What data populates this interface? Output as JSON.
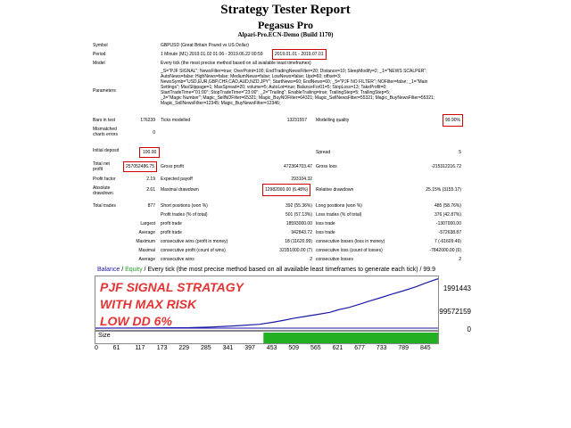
{
  "header": {
    "title": "Strategy Tester Report",
    "ea_name": "Pegasus Pro",
    "account": "Alpari-Pro.ECN-Demo (Build 1170)"
  },
  "report": {
    "symbol_label": "Symbol",
    "symbol_value": "GBPUSD (Great Britain Pound vs US Dollar)",
    "period_label": "Period",
    "period_value": "1 Minute (M1) 2019.01.02 01:06 - 2019.06.22 00:59",
    "period_highlight": "2019.01.01 - 2019.07.01",
    "model_label": "Model",
    "model_value": "Every tick (the most precise method based on all available least timeframes)",
    "params_label": "Parameters",
    "params_lines": [
      "_S=\"PJF SIGNAL\"; NewsFilter=true; OverPoint=100; EndTradingNewsFilter=20; Distance=10; SleepModify=2; _1=\"NEWS SCALPER\";",
      "AutoNews=false; HighNews=false; MediumNews=false; LowNews=false; Upd=60; offset=3;",
      "NewsSymb=\"USD,EUR,GBP,CHF,CAD,AUD,NZD,JPY\"; StartNews=60; EndNews=60; _5=\"PJF NO FILTER\"; NOFilter=false; _1=\"Main",
      "Settings\"; MaxSlippage=1; MaxSpread=20; volume=5; AutoLot=true; BalanceFor01=5; StopLoss=13; TakeProfit=0;",
      "StartTradeTime=\"01:00\"; StopTradeTime=\"23:00\"; _2=\"Trailing\"; EnableTrailing=true; TrailingStep=5; TrailingStep=5;",
      "_3=\"Magic Number\"; Magic_SellNOFilter=65321; Magic_BuyNOFilter=64321; Magic_SellNewsFilter=55321; Magic_BuyNewsFilter=55321;",
      "Magic_SellNewsFilter=12345; Magic_BuyNewsFilter=12346;"
    ],
    "bars_label": "Bars in test",
    "bars_value": "176239",
    "ticks_label": "Ticks modelled",
    "ticks_value": "13231557",
    "quality_label": "Modelling quality",
    "quality_value": "99.90%",
    "mismatch_label": "Mismatched charts errors",
    "mismatch_value": "0",
    "deposit_label": "Initial deposit",
    "deposit_value": "100.00",
    "spread_label": "Spread",
    "spread_value": "5",
    "netprofit_label": "Total net profit",
    "netprofit_value": "257052486.75",
    "grossprofit_label": "Gross profit",
    "grossprofit_value": "472364703.47",
    "grossloss_label": "Gross loss",
    "grossloss_value": "-215312216.72",
    "pf_label": "Profit factor",
    "pf_value": "2.19",
    "payoff_label": "Expected payoff",
    "payoff_value": "293104.32",
    "absdd_label": "Absolute drawdown",
    "absdd_value": "2.61",
    "maxdd_label": "Maximal drawdown",
    "maxdd_value": "12982000.00 (6.48%)",
    "reldd_label": "Relative drawdown",
    "reldd_value": "25.15% (3155.17)",
    "trades_label": "Total trades",
    "trades_value": "877",
    "short_label": "Short positions (won %)",
    "short_value": "392 (55.36%)",
    "long_label": "Long positions (won %)",
    "long_value": "485 (58.76%)",
    "pt_label": "Profit trades (% of total)",
    "pt_value": "501 (57.13%)",
    "lt_label": "Loss trades (% of total)",
    "lt_value": "376 (42.87%)",
    "largest_label": "Largest",
    "lp_label": "profit trade",
    "lp_value": "18593000.00",
    "ll_label": "loss trade",
    "ll_value": "-1307000.00",
    "average_label": "Average",
    "ap_label": "profit trade",
    "ap_value": "942843.72",
    "al_label": "loss trade",
    "al_value": "-572638.87",
    "maximum_label": "Maximum",
    "mcw_label": "consecutive wins (profit in money)",
    "mcw_value": "18 (11620.99)",
    "mcl_label": "consecutive losses (loss in money)",
    "mcl_value": "7 (-61609.49)",
    "maximal_label": "Maximal",
    "mcp_label": "consecutive profit (count of wins)",
    "mcp_value": "32351000.00 (7)",
    "mcloss_label": "consecutive loss (count of losses)",
    "mcloss_value": "-7842000.00 (6)",
    "avg2_label": "Average",
    "acw_label": "consecutive wins",
    "acw_value": "2",
    "acl_label": "consecutive losses",
    "acl_value": "2"
  },
  "chart_header": {
    "balance": "Balance",
    "sep1": " / ",
    "equity": "Equity",
    "sep2": " / ",
    "rest": "Every tick (the most precise method based on all available least timeframes to generate each tick)",
    "trail": " / 99.9"
  },
  "annotation": {
    "line1": "PJF SIGNAL STRATAGY",
    "line2": "WITH MAX RISK",
    "line3": "LOW DD   6%"
  },
  "size_label": "Size",
  "colors": {
    "balance": "#1a1aa8",
    "equity": "#2ca02c",
    "annotation": "#e53333",
    "highlight": "#cc0000"
  },
  "chart_data": {
    "type": "line",
    "title": "",
    "x_ticks": [
      "0",
      "61",
      "117",
      "173",
      "229",
      "285",
      "341",
      "397",
      "453",
      "509",
      "565",
      "621",
      "677",
      "733",
      "789",
      "845"
    ],
    "y_ticks": [
      "1991443",
      "99572159",
      "0"
    ],
    "xlim": [
      0,
      877
    ],
    "series": [
      {
        "name": "Balance",
        "x": [
          0,
          120,
          240,
          300,
          360,
          420,
          453,
          480,
          509,
          540,
          565,
          600,
          621,
          650,
          677,
          700,
          733,
          760,
          789,
          820,
          845,
          877
        ],
        "y": [
          0,
          500000,
          2500000,
          6000000,
          12000000,
          20000000,
          30000000,
          40000000,
          52000000,
          62000000,
          70000000,
          82000000,
          95000000,
          108000000,
          125000000,
          140000000,
          160000000,
          178000000,
          195000000,
          215000000,
          235000000,
          257052486
        ]
      }
    ],
    "size_bars_start": 430,
    "size_bars_end": 877
  }
}
